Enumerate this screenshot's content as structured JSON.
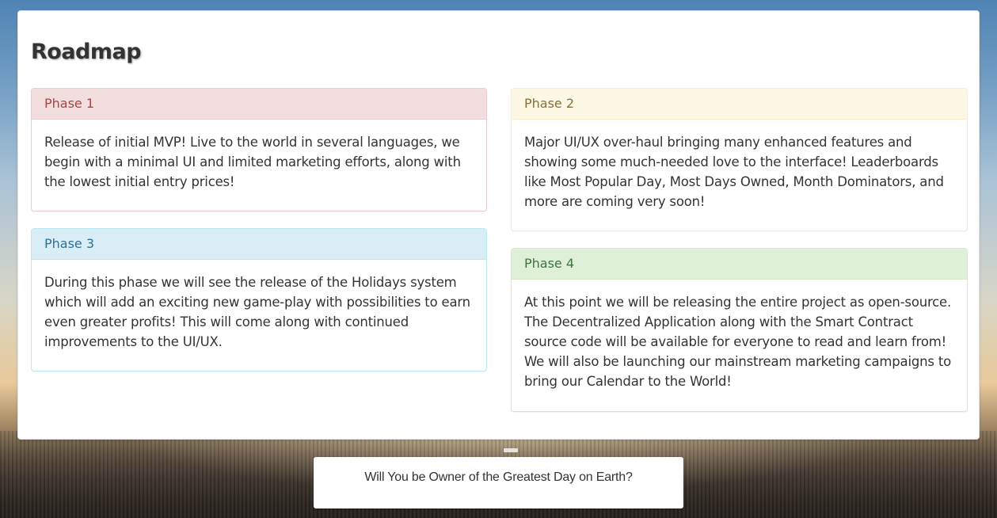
{
  "roadmap": {
    "title": "Roadmap",
    "phases": [
      {
        "heading": "Phase 1",
        "body": "Release of initial MVP! Live to the world in several languages, we begin with a minimal UI and limited marketing efforts, along with the lowest initial entry prices!"
      },
      {
        "heading": "Phase 2",
        "body": "Major UI/UX over-haul bringing many enhanced features and showing some much-needed love to the interface! Leaderboards like Most Popular Day, Most Days Owned, Month Dominators, and more are coming very soon!"
      },
      {
        "heading": "Phase 3",
        "body": "During this phase we will see the release of the Holidays system which will add an exciting new game-play with possibilities to earn even greater profits! This will come along with continued improvements to the UI/UX."
      },
      {
        "heading": "Phase 4",
        "body": "At this point we will be releasing the entire project as open-source. The Decentralized Application along with the Smart Contract source code will be available for everyone to read and learn from! We will also be launching our mainstream marketing campaigns to bring our Calendar to the World!"
      }
    ]
  },
  "cta": {
    "text": "Will You be Owner of the Greatest Day on Earth?"
  },
  "colors": {
    "phase1": "#f2dede",
    "phase2": "#fcf8e3",
    "phase3": "#d9edf7",
    "phase4": "#dff0d8"
  }
}
